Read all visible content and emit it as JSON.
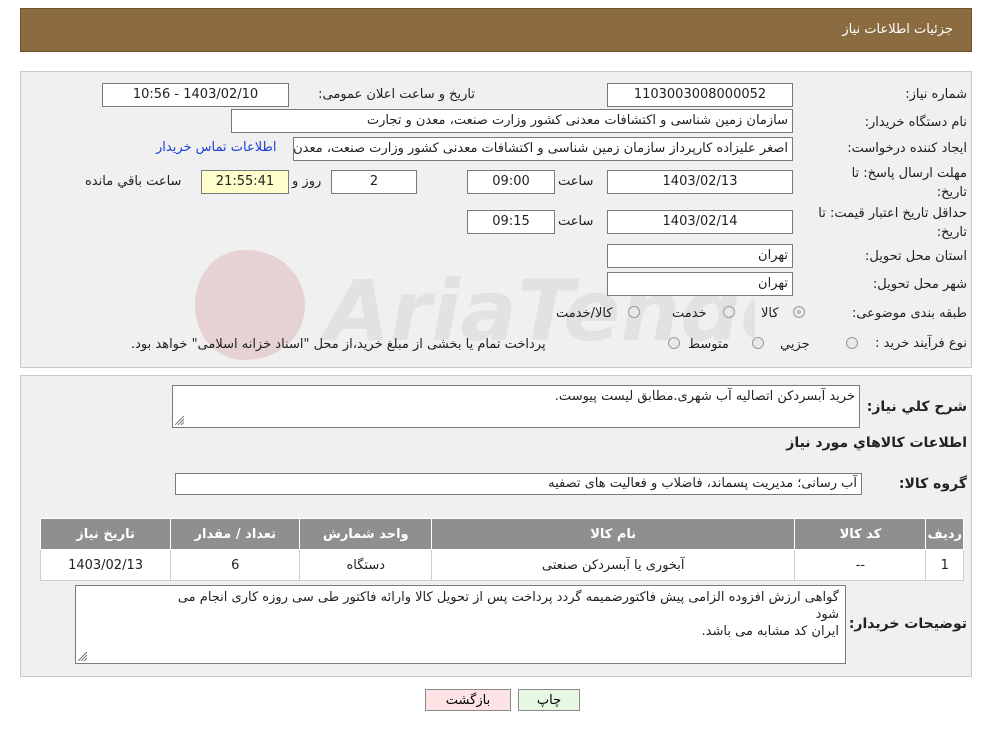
{
  "header": {
    "title": "جزئیات اطلاعات نیاز"
  },
  "form": {
    "need_number_label": "شماره نیاز:",
    "need_number": "1103003008000052",
    "announce_label": "تاریخ و ساعت اعلان عمومی:",
    "announce_value": "1403/02/10 - 10:56",
    "buyer_org_label": "نام دستگاه خریدار:",
    "buyer_org": "سازمان زمین شناسی و اکتشافات معدنی کشور وزارت صنعت، معدن و تجارت",
    "creator_label": "ایجاد کننده درخواست:",
    "creator": "اصغر علیزاده کارپرداز سازمان زمین شناسی و اکتشافات معدنی کشور وزارت صنعت، معدن و تجارت",
    "contact_link": "اطلاعات تماس خریدار",
    "reply_deadline_label_1": "مهلت ارسال پاسخ: تا",
    "reply_deadline_label_2": "تاریخ:",
    "reply_date": "1403/02/13",
    "time_label": "ساعت",
    "reply_time": "09:00",
    "days_value": "2",
    "days_label": "روز و",
    "remaining_time": "21:55:41",
    "remaining_label": "ساعت باقي مانده",
    "validity_label_1": "حداقل تاریخ اعتبار قیمت: تا",
    "validity_label_2": "تاریخ:",
    "validity_date": "1403/02/14",
    "validity_time": "09:15",
    "province_label": "استان محل تحویل:",
    "province": "تهران",
    "city_label": "شهر محل تحویل:",
    "city": "تهران",
    "category_label": "طبقه بندی موضوعی:",
    "category_options": [
      "کالا",
      "خدمت",
      "کالا/خدمت"
    ],
    "process_label": "نوع فرآیند خرید :",
    "process_options": [
      "جزیي",
      "متوسط"
    ],
    "process_note": "پرداخت تمام یا بخشی از مبلغ خرید،از محل \"اسناد خزانه اسلامی\" خواهد بود."
  },
  "details": {
    "description_label": "شرح کلي نیاز:",
    "description": "خرید آبسردکن اتصالیه آب شهری.مطابق لیست پیوست.",
    "goods_info_title": "اطلاعات کالاهاي مورد نیاز",
    "group_label": "گروه کالا:",
    "group_value": "آب رسانی؛ مدیریت پسماند، فاضلاب و فعالیت های تصفیه",
    "table": {
      "headers": [
        "ردیف",
        "کد کالا",
        "نام کالا",
        "واحد شمارش",
        "تعداد / مقدار",
        "تاریخ نیاز"
      ],
      "rows": [
        [
          "1",
          "--",
          "آبخوری یا آبسردکن صنعتی",
          "دستگاه",
          "6",
          "1403/02/13"
        ]
      ]
    },
    "buyer_notes_label": "توضیحات خریدار:",
    "buyer_notes_line1": "گواهی ارزش افزوده الزامی پیش فاکتورضمیمه گردد پرداخت پس از تحویل کالا وارائه فاکتور طی سی روزه کاری انجام می",
    "buyer_notes_line2": "شود",
    "buyer_notes_line3": "ایران کد مشابه می باشد."
  },
  "buttons": {
    "print": "چاپ",
    "back": "بازگشت"
  },
  "colors": {
    "header": "#8b6b40",
    "back_button": "#fde3e3",
    "print_button": "#e6f7e2",
    "remaining_box": "#ffffcc"
  }
}
